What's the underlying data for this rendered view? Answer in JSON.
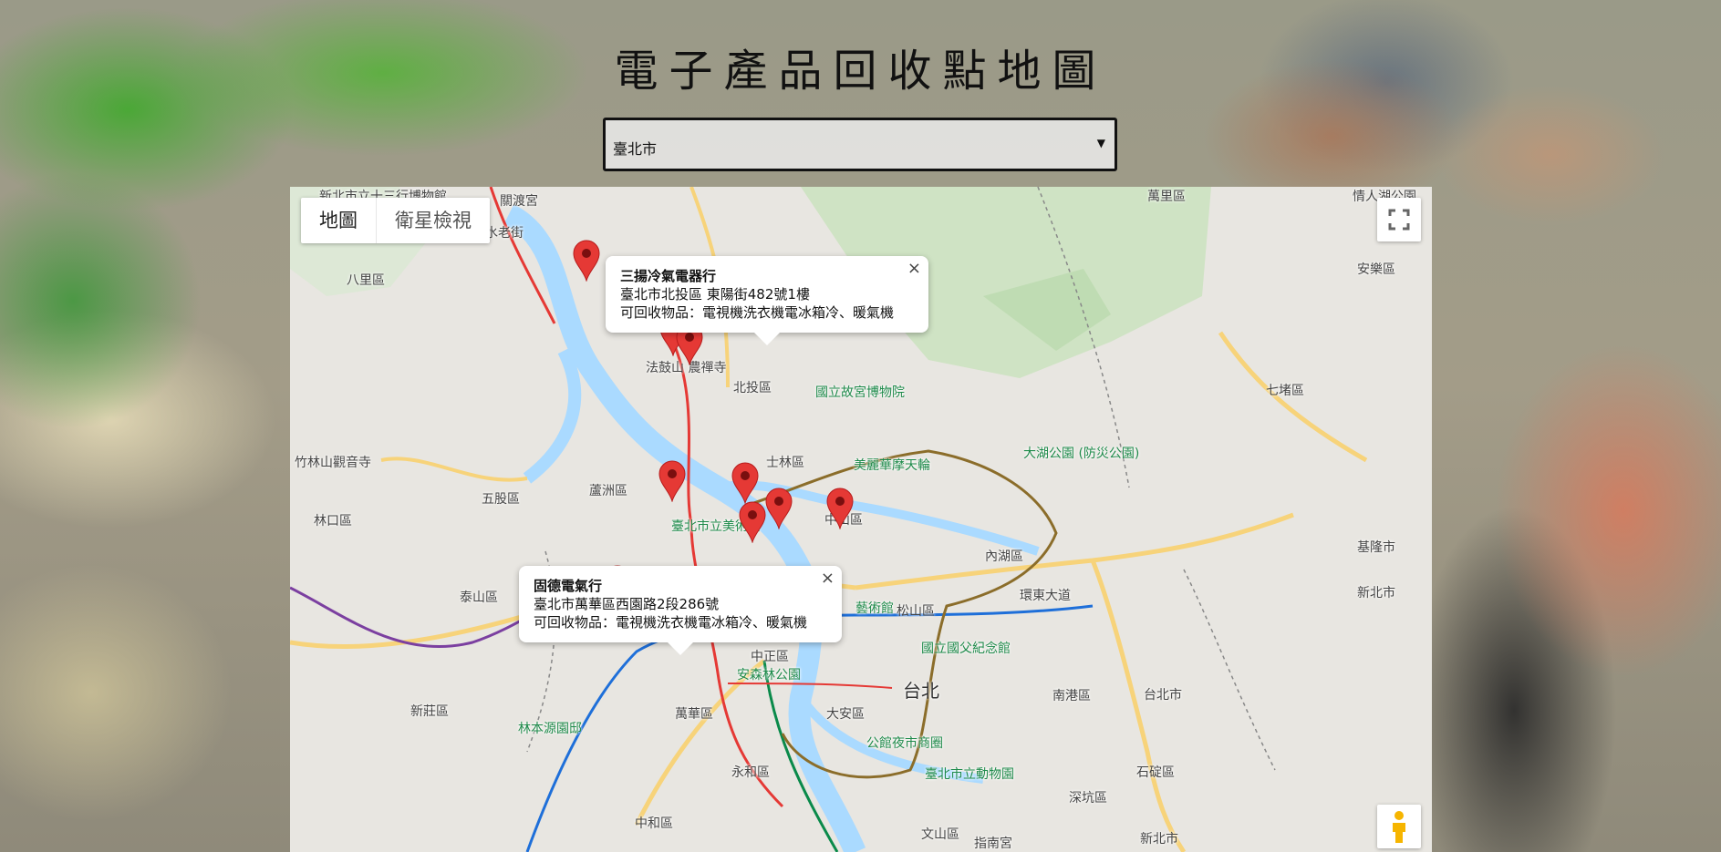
{
  "page": {
    "title": "電子產品回收點地圖"
  },
  "city_select": {
    "value": "臺北市",
    "arrow": "▼"
  },
  "map": {
    "type_buttons": {
      "map": "地圖",
      "satellite": "衛星檢視"
    },
    "icons": {
      "fullscreen": "fullscreen-icon",
      "pegman": "pegman-icon",
      "marker": "map-pin-icon"
    },
    "colors": {
      "marker": "#e53935",
      "water": "#aadaff",
      "park": "#c8e6c9"
    },
    "labels": [
      "新北市立十三行博物館",
      "萬里區",
      "情人湖公園",
      "八里區",
      "關渡宮",
      "淡水老街",
      "安樂區",
      "法鼓山 農禪寺",
      "北投區",
      "國立故宮博物院",
      "七堵區",
      "竹林山觀音寺",
      "士林區",
      "美麗華摩天輪",
      "大湖公園 (防災公園)",
      "五股區",
      "蘆洲區",
      "林口區",
      "臺北市立美術館",
      "中山區",
      "內湖區",
      "泰山區",
      "藝術館",
      "松山區",
      "環東大道",
      "基隆市",
      "新北市",
      "中正區",
      "國立國父紀念館",
      "安森林公園",
      "台北",
      "南港區",
      "新莊區",
      "林本源園邸",
      "萬華區",
      "大安區",
      "公館夜市商圈",
      "台北市",
      "石碇區",
      "永和區",
      "臺北市立動物園",
      "深坑區",
      "中和區",
      "文山區",
      "指南宮",
      "新北市"
    ],
    "info_windows": [
      {
        "name": "三揚冷氣電器行",
        "address": "臺北市北投區 東陽街482號1樓",
        "items": "可回收物品：電視機洗衣機電冰箱冷、暖氣機"
      },
      {
        "name": "固德電氣行",
        "address": "臺北市萬華區西園路2段286號",
        "items": "可回收物品：電視機洗衣機電冰箱冷、暖氣機"
      }
    ],
    "info_close": "×"
  }
}
